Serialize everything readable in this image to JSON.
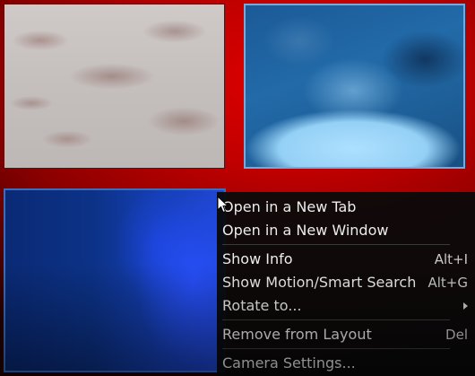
{
  "tiles": [
    {
      "name": "camera-tile-1",
      "tone": "gray-beige"
    },
    {
      "name": "camera-tile-2",
      "tone": "light-blue"
    },
    {
      "name": "camera-tile-3",
      "tone": "deep-blue"
    }
  ],
  "colors": {
    "background": "#c00000",
    "menu_bg": "#0a0a0a",
    "menu_text": "#ececec",
    "selected_border": "#7aa8d8"
  },
  "context_menu": {
    "open_new_tab": "Open in a New Tab",
    "open_new_window": "Open in a New Window",
    "show_info": "Show Info",
    "show_info_shortcut": "Alt+I",
    "show_motion_search": "Show Motion/Smart Search",
    "show_motion_search_shortcut": "Alt+G",
    "rotate_to": "Rotate to...",
    "remove_from_layout": "Remove from Layout",
    "remove_from_layout_shortcut": "Del",
    "camera_settings": "Camera Settings..."
  }
}
